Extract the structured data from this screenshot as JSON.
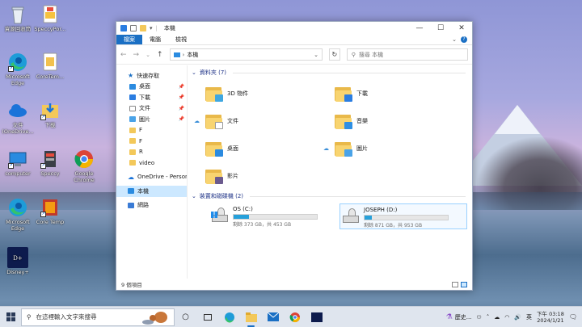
{
  "desktop": {
    "icons": [
      {
        "label": "資源回收筒",
        "icon": "recycle-bin-icon"
      },
      {
        "label": "SpeccyPor...",
        "icon": "speccy-portable-icon"
      },
      {
        "label": "Microsoft Edge",
        "icon": "edge-icon"
      },
      {
        "label": "CoreTem...",
        "icon": "coretemp-file-icon"
      },
      {
        "label": "文件 (OneDrive...",
        "icon": "onedrive-icon"
      },
      {
        "label": "下載",
        "icon": "download-folder-icon"
      },
      {
        "label": "computer",
        "icon": "computer-icon"
      },
      {
        "label": "Speccy",
        "icon": "speccy-icon"
      },
      {
        "label": "Google Chrome",
        "icon": "chrome-icon"
      },
      {
        "label": "Microsoft Edge",
        "icon": "edge-icon"
      },
      {
        "label": "Core Temp",
        "icon": "coretemp-icon"
      },
      {
        "label": "Disney+",
        "icon": "disney-plus-icon"
      }
    ]
  },
  "window": {
    "title": "本機",
    "ribbon_tabs": [
      "檔案",
      "電腦",
      "檢視"
    ],
    "address": "本機",
    "search_placeholder": "搜尋 本機",
    "sidebar": [
      {
        "label": "快速存取",
        "pinned": false
      },
      {
        "label": "桌面",
        "pinned": true
      },
      {
        "label": "下載",
        "pinned": true
      },
      {
        "label": "文件",
        "pinned": true
      },
      {
        "label": "圖片",
        "pinned": true
      },
      {
        "label": "F",
        "pinned": false
      },
      {
        "label": "F",
        "pinned": false
      },
      {
        "label": "R",
        "pinned": false
      },
      {
        "label": "video",
        "pinned": false
      },
      {
        "label": "OneDrive - Persona",
        "pinned": false
      },
      {
        "label": "本機",
        "pinned": false
      },
      {
        "label": "網路",
        "pinned": false
      }
    ],
    "folders_header": "資料夾 (7)",
    "folders": [
      {
        "label": "3D 物件",
        "badge_color": "#3fa7e0",
        "cloud": false
      },
      {
        "label": "下載",
        "badge_color": "#2a7de1",
        "cloud": false
      },
      {
        "label": "文件",
        "badge_color": "#ffffff",
        "cloud": true
      },
      {
        "label": "音樂",
        "badge_color": "#2f8fe3",
        "cloud": false
      },
      {
        "label": "桌面",
        "badge_color": "#2b8be0",
        "cloud": false
      },
      {
        "label": "圖片",
        "badge_color": "#4aa3e8",
        "cloud": true
      },
      {
        "label": "影片",
        "badge_color": "#6b5a8e",
        "cloud": false
      }
    ],
    "drives_header": "裝置和磁碟機 (2)",
    "drives": [
      {
        "name": "OS (C:)",
        "used_fraction": 0.18,
        "size_text": "剩餘 373 GB，共 453 GB"
      },
      {
        "name": "JOSEPH (D:)",
        "used_fraction": 0.09,
        "size_text": "剩餘 871 GB，共 953 GB"
      }
    ],
    "status_text": "9 個項目"
  },
  "taskbar": {
    "search_placeholder": "在這裡輸入文字來搜尋",
    "apps": [
      "task-view-icon",
      "edge-icon",
      "file-explorer-icon",
      "mail-icon",
      "chrome-icon",
      "disney-plus-icon"
    ],
    "weather_text": "歷史...",
    "ime": "英",
    "time": "下午 03:18",
    "date": "2024/1/21"
  }
}
